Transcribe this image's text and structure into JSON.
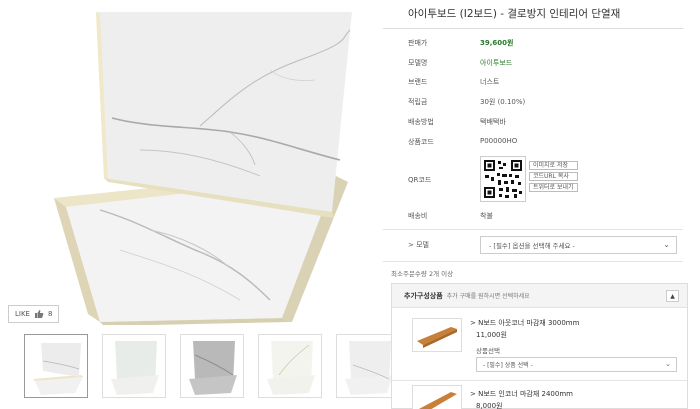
{
  "product": {
    "title": "아이투보드 (I2보드) - 결로방지 인테리어 단열재"
  },
  "details": [
    {
      "label": "판매가",
      "value": "39,600원",
      "kind": "price"
    },
    {
      "label": "모델명",
      "value": "아이투보드",
      "kind": "link"
    },
    {
      "label": "브랜드",
      "value": "너스트",
      "kind": "plain"
    },
    {
      "label": "적립금",
      "value": "30원 (0.10%)",
      "kind": "plain"
    },
    {
      "label": "배송방법",
      "value": "택배택바",
      "kind": "plain"
    },
    {
      "label": "상품코드",
      "value": "P00000HO",
      "kind": "plain"
    }
  ],
  "qr": {
    "label": "QR코드",
    "buttons": [
      "이미지로 저장",
      "코드URL 복사",
      "트위터로 보내기"
    ]
  },
  "shipping": {
    "label": "배송비",
    "value": "착불"
  },
  "option": {
    "label": "> 모델",
    "placeholder": "- [필수] 옵션을 선택해 주세요 -"
  },
  "min_qty": "최소주문수량 2개 이상",
  "addon": {
    "title": "추가구성상품",
    "desc": "추가 구매를 원하시면 선택하세요",
    "toggle": "▲",
    "items": [
      {
        "name": "> N보드 아웃코너 마감재 3000mm",
        "price": "11,000원",
        "sel_label": "상품선택",
        "sel_placeholder": "- [필수] 상품 선택 -"
      },
      {
        "name": "> N보드 인코너 마감재 2400mm",
        "price": "8,000원"
      }
    ]
  },
  "like": {
    "label": "LIKE",
    "count": "8"
  },
  "colors": {
    "accent_green": "#2a7a2a",
    "marble": "#f2f2f2",
    "board_edge": "#e9e2c6"
  }
}
